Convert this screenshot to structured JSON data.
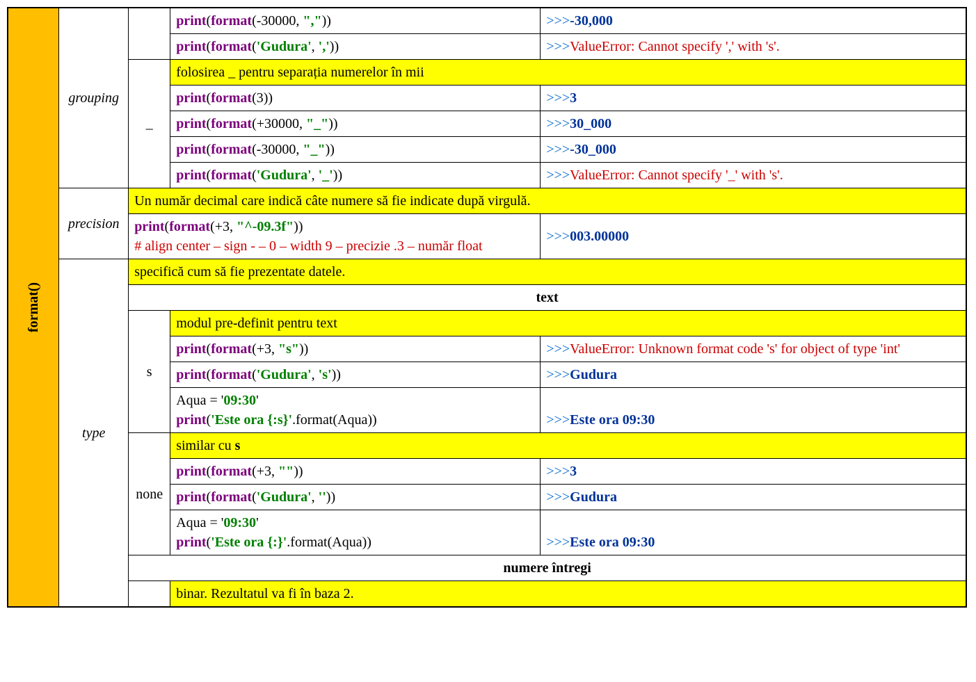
{
  "sideLabel": "format()",
  "groupingLabel": "grouping",
  "precisionLabel": "precision",
  "typeLabel": "type",
  "sub_underscore": "_",
  "sub_s": "s",
  "sub_none": "none",
  "textHeader": "text",
  "intHeader": "numere întregi",
  "rows": {
    "g1_code_print": "print",
    "g1_code_open": "(",
    "g1_code_func": "format",
    "g1_code_args_pre": "(-30000, ",
    "g1_code_str": "\",\"",
    "g1_code_close": "))",
    "g1_out_prompt": ">>>",
    "g1_out_val": "-30,000",
    "g2_code_args_pre": "(",
    "g2_code_str1": "'Gudura'",
    "g2_code_mid": ", ",
    "g2_code_str2": "','",
    "g2_code_close": "))",
    "g2_out_prompt": ">>>",
    "g2_out_err": "ValueError: Cannot specify ',' with 's'.",
    "g3_desc": "folosirea _ pentru separația numerelor în mii",
    "g4_code_args": "(3))",
    "g4_out_prompt": ">>>",
    "g4_out_val": "3",
    "g5_code_args_pre": "(+30000, ",
    "g5_code_str": "\"_\"",
    "g5_code_close": "))",
    "g5_out_prompt": ">>>",
    "g5_out_val": "30_000",
    "g6_code_args_pre": "(-30000, ",
    "g6_code_str": "\"_\"",
    "g6_code_close": "))",
    "g6_out_prompt": ">>>",
    "g6_out_val": "-30_000",
    "g7_code_args_pre": "(",
    "g7_code_str1": "'Gudura'",
    "g7_code_mid": ", ",
    "g7_code_str2": "'_'",
    "g7_code_close": "))",
    "g7_out_prompt": ">>>",
    "g7_out_err": "ValueError: Cannot specify '_' with 's'.",
    "p1_desc": "Un număr decimal care indică câte numere să fie indicate după virgulă.",
    "p2_code_args_pre": "(+3, ",
    "p2_code_str": "\"^-09.3f\"",
    "p2_code_close": "))",
    "p2_comment": "# align center – sign - – 0 – width 9 – precizie .3 – număr float",
    "p2_out_prompt": ">>>",
    "p2_out_val": "003.00000",
    "t1_desc": "specifică cum să fie prezentate datele.",
    "s1_desc": "modul pre-definit pentru text",
    "s2_code_args_pre": "(+3, ",
    "s2_code_str": "\"s\"",
    "s2_code_close": "))",
    "s2_out_prompt": ">>>",
    "s2_out_err": "ValueError: Unknown format code 's' for object of type 'int'",
    "s3_code_args_pre": "(",
    "s3_code_str1": "'Gudura'",
    "s3_code_mid": ", ",
    "s3_code_str2": "'s'",
    "s3_code_close": "))",
    "s3_out_prompt": ">>>",
    "s3_out_val": "Gudura",
    "s4_line1_pre": "Aqua = '",
    "s4_line1_str": "09:30",
    "s4_line1_post": "'",
    "s4_code_args_pre": "(",
    "s4_code_str": "'Este ora {:s}'",
    "s4_code_mid": ".format(Aqua))",
    "s4_out_prompt": ">>>",
    "s4_out_val": "Este ora 09:30",
    "n1_desc_pre": "similar cu ",
    "n1_desc_bold": "s",
    "n2_code_args_pre": "(+3, ",
    "n2_code_str": "\"\"",
    "n2_code_close": "))",
    "n2_out_prompt": ">>>",
    "n2_out_val": "3",
    "n3_code_args_pre": "(",
    "n3_code_str1": "'Gudura'",
    "n3_code_mid": ", ",
    "n3_code_str2": "''",
    "n3_code_close": "))",
    "n3_out_prompt": ">>>",
    "n3_out_val": "Gudura",
    "n4_line1_pre": "Aqua = '",
    "n4_line1_str": "09:30",
    "n4_line1_post": "'",
    "n4_code_args_pre": "(",
    "n4_code_str": "'Este ora {:}'",
    "n4_code_mid": ".format(Aqua))",
    "n4_out_prompt": ">>>",
    "n4_out_val": "Este ora 09:30",
    "b1_desc": "binar. Rezultatul va fi în baza 2."
  }
}
